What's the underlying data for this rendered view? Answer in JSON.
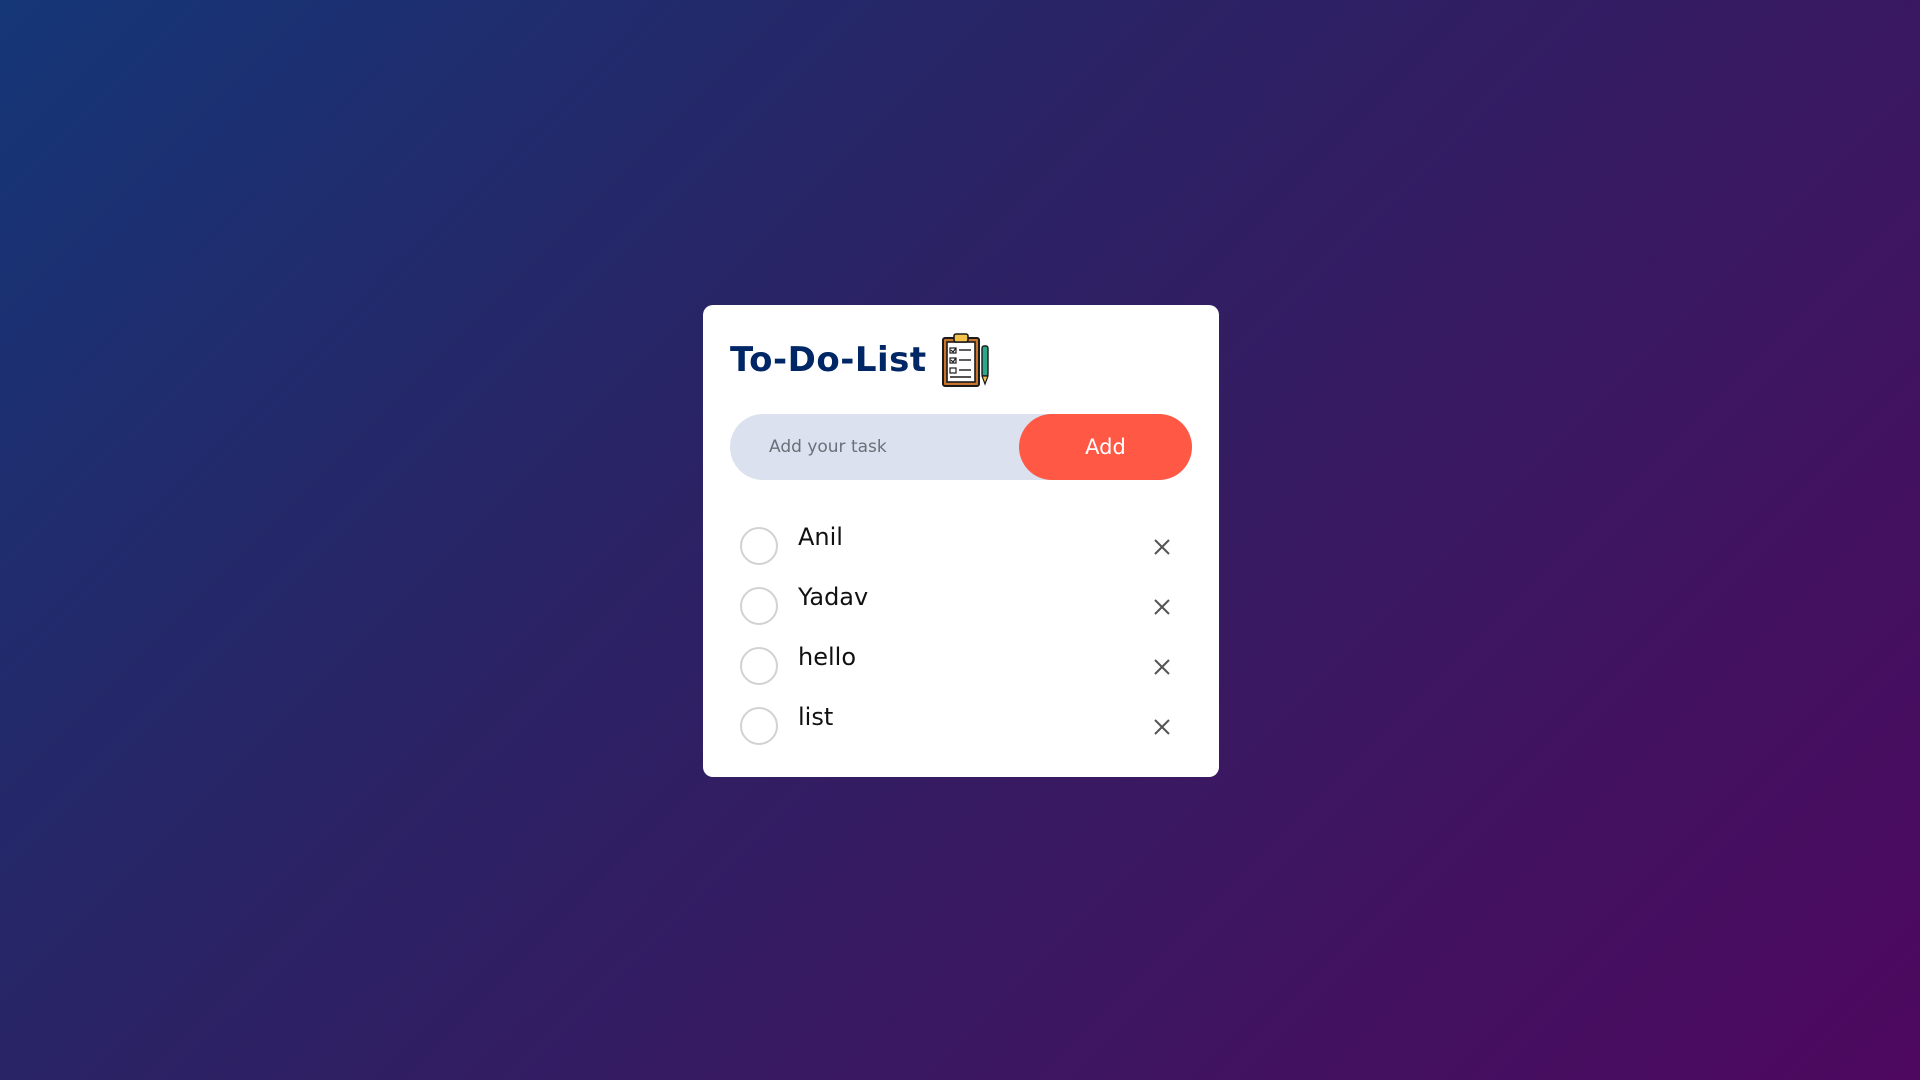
{
  "app": {
    "title": "To-Do-List",
    "logo_icon": "clipboard-checklist-icon"
  },
  "input": {
    "placeholder": "Add your task",
    "value": ""
  },
  "add_button": {
    "label": "Add"
  },
  "tasks": [
    {
      "label": "Anil",
      "checked": false
    },
    {
      "label": "Yadav",
      "checked": false
    },
    {
      "label": "hello",
      "checked": false
    },
    {
      "label": "list",
      "checked": false
    }
  ],
  "colors": {
    "title": "#002765",
    "accent": "#ff5945",
    "input_bg": "#dbe1ee",
    "bg_start": "#153677",
    "bg_end": "#4e085f"
  }
}
